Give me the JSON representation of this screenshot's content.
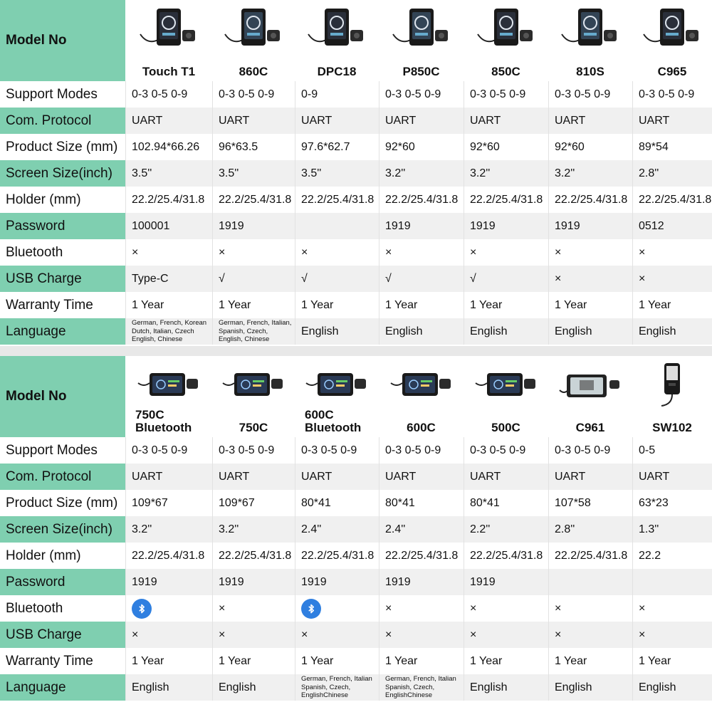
{
  "colors": {
    "accent": "#7fcfb0",
    "bluetooth": "#2f7fe0"
  },
  "row_labels": {
    "model": "Model No",
    "modes": "Support Modes",
    "protocol": "Com. Protocol",
    "product_size": "Product Size (mm)",
    "screen_size": "Screen Size(inch)",
    "holder": "Holder (mm)",
    "password": "Password",
    "bluetooth": "Bluetooth",
    "usb": "USB Charge",
    "warranty": "Warranty Time",
    "language": "Language"
  },
  "table1": {
    "models": [
      {
        "name": "Touch T1",
        "modes": "0-3 0-5 0-9",
        "protocol": "UART",
        "product_size": "102.94*66.26",
        "screen": "3.5''",
        "holder": "22.2/25.4/31.8",
        "password": "100001",
        "bluetooth": "×",
        "usb": "Type-C",
        "warranty": "1 Year",
        "language": "German, French, Korean Dutch, Italian, Czech English, Chinese"
      },
      {
        "name": "860C",
        "modes": "0-3 0-5 0-9",
        "protocol": "UART",
        "product_size": "96*63.5",
        "screen": "3.5''",
        "holder": "22.2/25.4/31.8",
        "password": "1919",
        "bluetooth": "×",
        "usb": "√",
        "warranty": "1 Year",
        "language": "German, French, Italian, Spanish, Czech, English, Chinese"
      },
      {
        "name": "DPC18",
        "modes": "0-9",
        "protocol": "UART",
        "product_size": "97.6*62.7",
        "screen": "3.5''",
        "holder": "22.2/25.4/31.8",
        "password": "",
        "bluetooth": "×",
        "usb": "√",
        "warranty": "1 Year",
        "language": "English"
      },
      {
        "name": "P850C",
        "modes": "0-3 0-5 0-9",
        "protocol": "UART",
        "product_size": "92*60",
        "screen": "3.2''",
        "holder": "22.2/25.4/31.8",
        "password": "1919",
        "bluetooth": "×",
        "usb": "√",
        "warranty": "1 Year",
        "language": "English"
      },
      {
        "name": "850C",
        "modes": "0-3 0-5 0-9",
        "protocol": "UART",
        "product_size": "92*60",
        "screen": "3.2''",
        "holder": "22.2/25.4/31.8",
        "password": "1919",
        "bluetooth": "×",
        "usb": "√",
        "warranty": "1 Year",
        "language": "English"
      },
      {
        "name": "810S",
        "modes": "0-3 0-5 0-9",
        "protocol": "UART",
        "product_size": "92*60",
        "screen": "3.2''",
        "holder": "22.2/25.4/31.8",
        "password": "1919",
        "bluetooth": "×",
        "usb": "×",
        "warranty": "1 Year",
        "language": "English"
      },
      {
        "name": "C965",
        "modes": "0-3 0-5 0-9",
        "protocol": "UART",
        "product_size": "89*54",
        "screen": "2.8''",
        "holder": "22.2/25.4/31.8",
        "password": "0512",
        "bluetooth": "×",
        "usb": "×",
        "warranty": "1 Year",
        "language": "English"
      }
    ]
  },
  "table2": {
    "models": [
      {
        "name": "750C Bluetooth",
        "modes": "0-3 0-5 0-9",
        "protocol": "UART",
        "product_size": "109*67",
        "screen": "3.2''",
        "holder": "22.2/25.4/31.8",
        "password": "1919",
        "bluetooth": "icon",
        "usb": "×",
        "warranty": "1 Year",
        "language": "English"
      },
      {
        "name": "750C",
        "modes": "0-3 0-5 0-9",
        "protocol": "UART",
        "product_size": "109*67",
        "screen": "3.2''",
        "holder": "22.2/25.4/31.8",
        "password": "1919",
        "bluetooth": "×",
        "usb": "×",
        "warranty": "1 Year",
        "language": "English"
      },
      {
        "name": "600C Bluetooth",
        "modes": "0-3 0-5 0-9",
        "protocol": "UART",
        "product_size": "80*41",
        "screen": "2.4''",
        "holder": "22.2/25.4/31.8",
        "password": "1919",
        "bluetooth": "icon",
        "usb": "×",
        "warranty": "1 Year",
        "language": "German, French, Italian Spanish, Czech, EnglishChinese"
      },
      {
        "name": "600C",
        "modes": "0-3 0-5 0-9",
        "protocol": "UART",
        "product_size": "80*41",
        "screen": "2.4''",
        "holder": "22.2/25.4/31.8",
        "password": "1919",
        "bluetooth": "×",
        "usb": "×",
        "warranty": "1 Year",
        "language": "German, French, Italian Spanish, Czech, EnglishChinese"
      },
      {
        "name": "500C",
        "modes": "0-3 0-5 0-9",
        "protocol": "UART",
        "product_size": "80*41",
        "screen": "2.2''",
        "holder": "22.2/25.4/31.8",
        "password": "1919",
        "bluetooth": "×",
        "usb": "×",
        "warranty": "1 Year",
        "language": "English"
      },
      {
        "name": "C961",
        "modes": "0-3 0-5 0-9",
        "protocol": "UART",
        "product_size": "107*58",
        "screen": "2.8''",
        "holder": "22.2/25.4/31.8",
        "password": "",
        "bluetooth": "×",
        "usb": "×",
        "warranty": "1 Year",
        "language": "English"
      },
      {
        "name": "SW102",
        "modes": "0-5",
        "protocol": "UART",
        "product_size": "63*23",
        "screen": "1.3''",
        "holder": "22.2",
        "password": "",
        "bluetooth": "×",
        "usb": "×",
        "warranty": "1 Year",
        "language": "English"
      }
    ]
  }
}
